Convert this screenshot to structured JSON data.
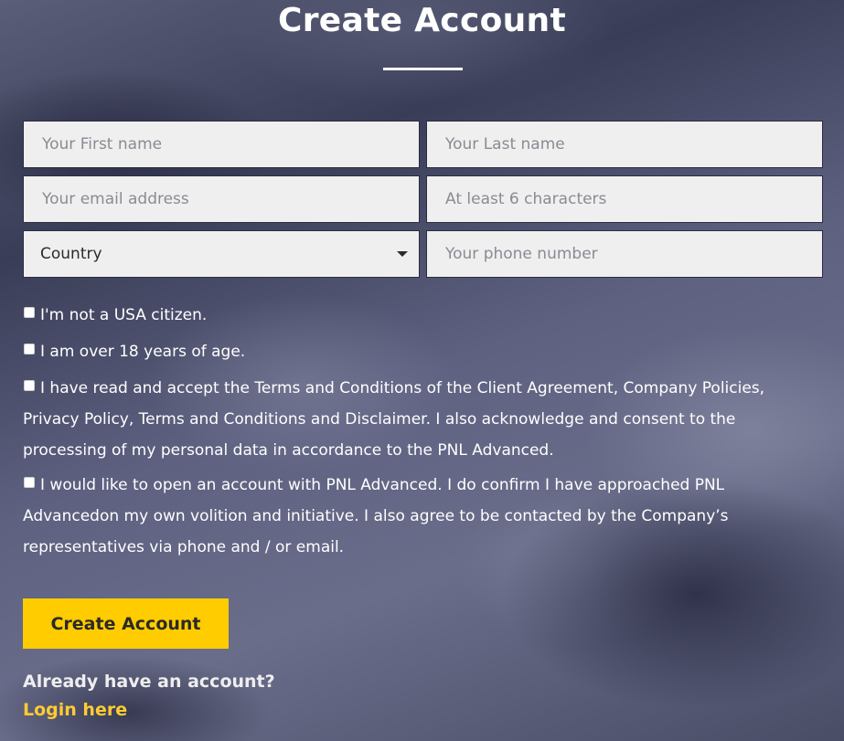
{
  "header": {
    "title": "Create Account"
  },
  "form": {
    "first_name": {
      "value": "",
      "placeholder": "Your First name"
    },
    "last_name": {
      "value": "",
      "placeholder": "Your Last name"
    },
    "email": {
      "value": "",
      "placeholder": "Your email address"
    },
    "password": {
      "value": "",
      "placeholder": "At least 6 characters"
    },
    "country": {
      "selected": "Country",
      "icon": "caret-down-icon"
    },
    "phone": {
      "value": "",
      "placeholder": "Your phone number"
    }
  },
  "checkboxes": [
    {
      "label": "I'm not a USA citizen.",
      "checked": false
    },
    {
      "label": "I am over 18 years of age.",
      "checked": false
    },
    {
      "label": "I have read and accept the Terms and Conditions of the Client Agreement, Company Policies, Privacy Policy, Terms and Conditions and Disclaimer. I also acknowledge and consent to the processing of my personal data in accordance to the PNL Advanced.",
      "checked": false
    },
    {
      "label": "I would like to open an account with PNL Advanced. I do confirm I have approached PNL Advancedon my own volition and initiative. I also agree to be contacted by the Company’s representatives via phone and / or email.",
      "checked": false
    }
  ],
  "actions": {
    "submit_label": "Create Account",
    "already_text": "Already have an account?",
    "login_label": "Login here"
  },
  "colors": {
    "accent": "#ffcc00",
    "link": "#ffcc33",
    "field_bg": "#efefef"
  }
}
